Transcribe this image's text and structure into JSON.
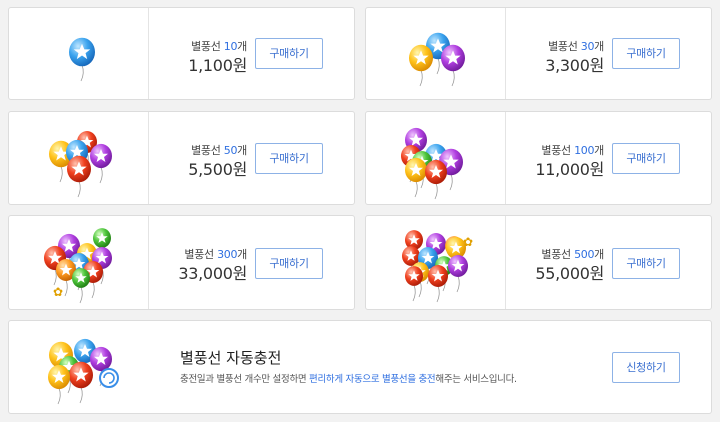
{
  "products": [
    {
      "prefix": "별풍선 ",
      "count": "10",
      "suffix": "개",
      "price": "1,100원",
      "button": "구매하기",
      "balloon_icon": "balloon-1-icon"
    },
    {
      "prefix": "별풍선 ",
      "count": "30",
      "suffix": "개",
      "price": "3,300원",
      "button": "구매하기",
      "balloon_icon": "balloon-3-icon"
    },
    {
      "prefix": "별풍선 ",
      "count": "50",
      "suffix": "개",
      "price": "5,500원",
      "button": "구매하기",
      "balloon_icon": "balloon-5-icon"
    },
    {
      "prefix": "별풍선 ",
      "count": "100",
      "suffix": "개",
      "price": "11,000원",
      "button": "구매하기",
      "balloon_icon": "balloon-bunch-icon"
    },
    {
      "prefix": "별풍선 ",
      "count": "300",
      "suffix": "개",
      "price": "33,000원",
      "button": "구매하기",
      "balloon_icon": "balloon-butterfly-icon"
    },
    {
      "prefix": "별풍선 ",
      "count": "500",
      "suffix": "개",
      "price": "55,000원",
      "button": "구매하기",
      "balloon_icon": "balloon-large-bunch-icon"
    }
  ],
  "auto_charge": {
    "title": "별풍선 자동충전",
    "desc_part1": "충전일과 별풍선 개수만 설정하면 ",
    "desc_highlight1": "편리하게 자동으로 별풍선을 충전",
    "desc_part2": "해주는 서비스입니다.",
    "button": "신청하기",
    "icon": "auto-recharge-icon"
  },
  "colors": {
    "accent": "#2f6fe0",
    "button_border": "#8db2e6",
    "card_border": "#dcdcdc",
    "background": "#f2f2f2"
  }
}
